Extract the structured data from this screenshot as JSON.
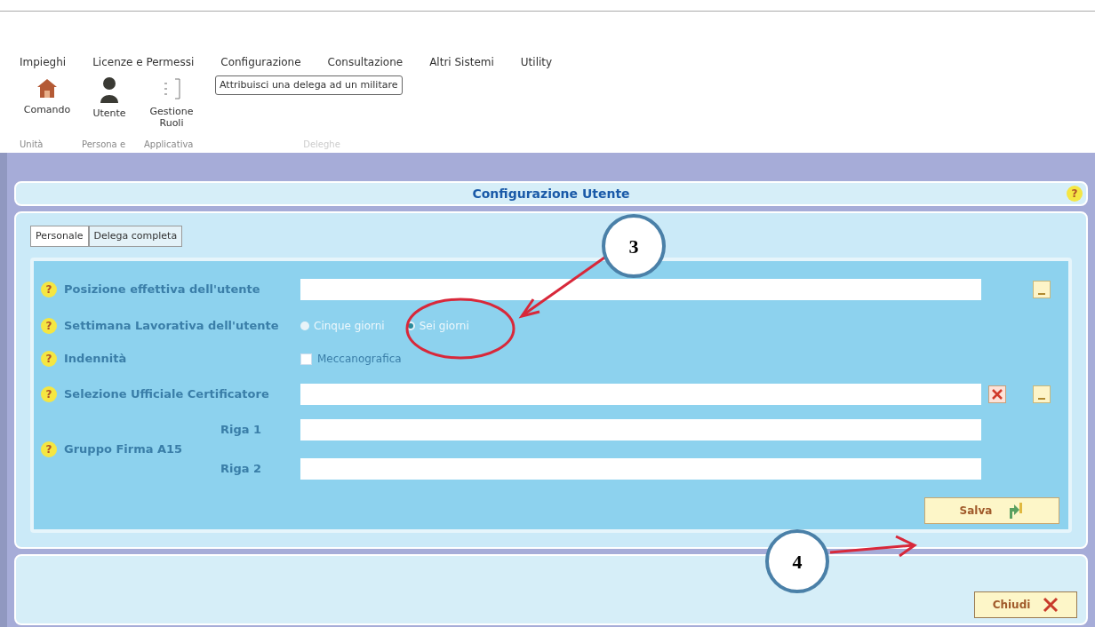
{
  "menu": [
    {
      "label": "Impieghi"
    },
    {
      "label": "Licenze e Permessi"
    },
    {
      "label": "Configurazione"
    },
    {
      "label": "Consultazione"
    },
    {
      "label": "Altri Sistemi"
    },
    {
      "label": "Utility"
    }
  ],
  "ribbon_groups": [
    {
      "label": "Unità",
      "items": [
        {
          "kind": "house",
          "label": "Comando"
        }
      ]
    },
    {
      "label": "Persona e",
      "items": [
        {
          "kind": "person",
          "label": "Utente"
        }
      ]
    },
    {
      "label": "Applicativa",
      "items": [
        {
          "kind": "list",
          "label": "Gestione Ruoli"
        }
      ]
    },
    {
      "label": "Deleghe",
      "items": [
        {
          "kind": "button",
          "label": "Attribuisci una delega ad un militare"
        }
      ]
    }
  ],
  "title": "Configurazione Utente",
  "title_help": "?",
  "tabs": [
    {
      "label": "Personale",
      "selected": true
    },
    {
      "label": "Delega completa",
      "selected": false
    }
  ],
  "fields": [
    {
      "kind": "text",
      "help": "?",
      "label": "Posizione effettiva dell'utente",
      "clear_button": false,
      "browse_button": true
    },
    {
      "kind": "radio",
      "help": "?",
      "label": "Settimana Lavorativa dell'utente",
      "disabled": true,
      "options": [
        {
          "label": "Cinque giorni",
          "selected": false
        },
        {
          "label": "Sei giorni",
          "selected": true
        }
      ]
    },
    {
      "kind": "checkbox",
      "help": "?",
      "label": "Indennità",
      "options": [
        {
          "label": "Meccanografica",
          "checked": false
        }
      ]
    },
    {
      "kind": "text",
      "help": "?",
      "label": "Selezione Ufficiale Certificatore",
      "clear_button": true,
      "browse_button": true
    },
    {
      "kind": "multi",
      "help": "?",
      "label": "Gruppo Firma A15",
      "lines": [
        {
          "label": "Riga 1"
        },
        {
          "label": "Riga 2"
        }
      ]
    }
  ],
  "save_button": "Salva",
  "close_button": "Chiudi",
  "annotations": [
    {
      "number": "3"
    },
    {
      "number": "4"
    }
  ]
}
